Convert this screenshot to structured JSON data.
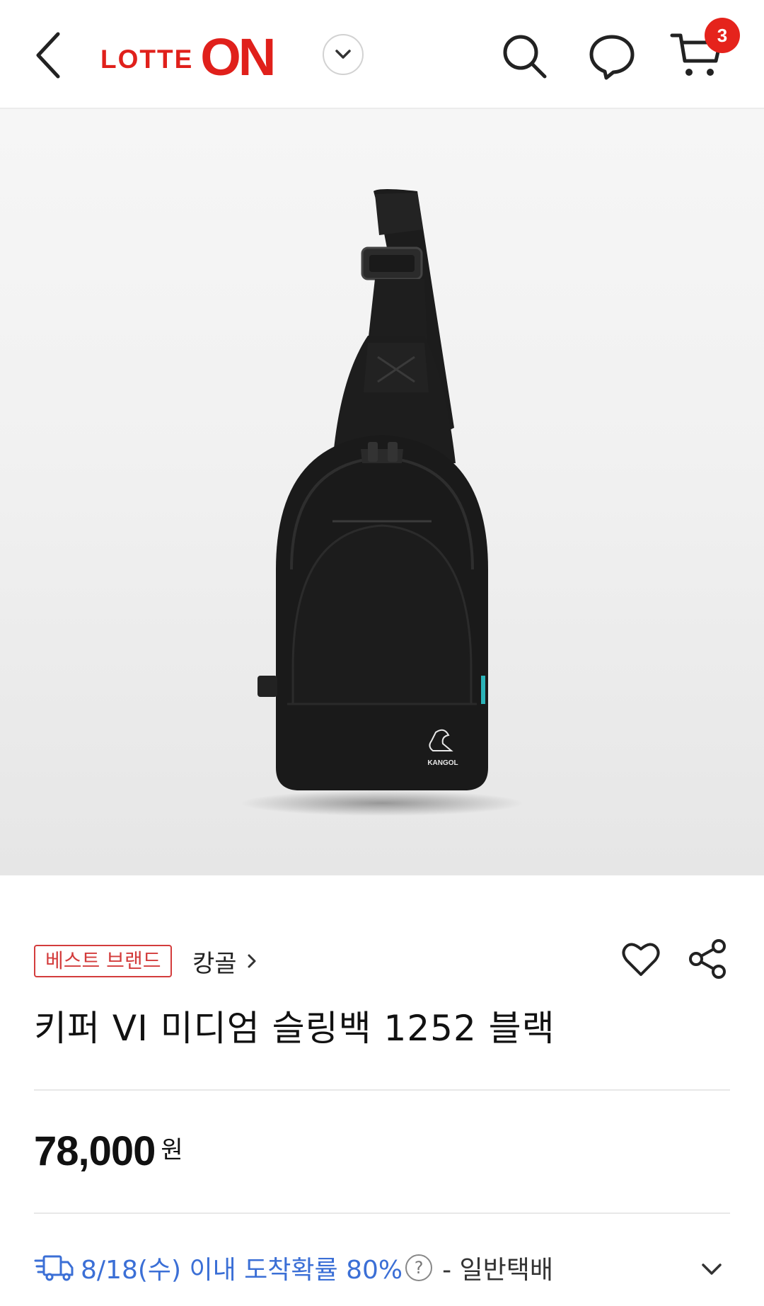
{
  "header": {
    "logo_lotte": "LOTTE",
    "logo_on": "ON",
    "cart_count": "3",
    "accent_color": "#e0201b"
  },
  "product": {
    "badge": "베스트 브랜드",
    "brand": "캉골",
    "name": "키퍼 VI 미디엄 슬링백 1252 블랙",
    "price": "78,000",
    "currency": "원",
    "image_logo_text": "KANGOL"
  },
  "delivery": {
    "arrival": "8/18(수) 이내 도착확률 80%",
    "help": "?",
    "method": "- 일반택배",
    "accent_color": "#3b6fd6"
  }
}
